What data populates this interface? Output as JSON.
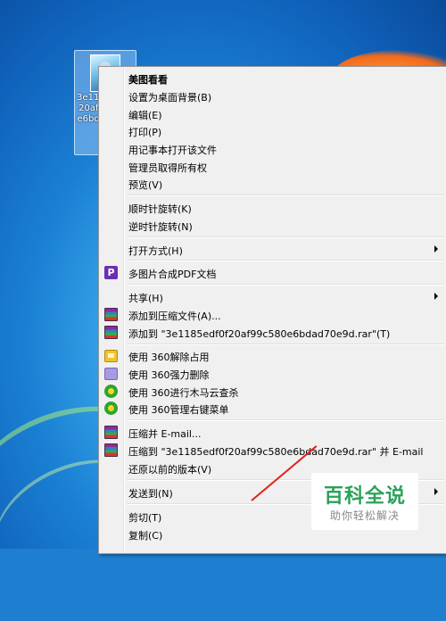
{
  "desktop_icon": {
    "filename": "3e1185edf0f20af99c580e6bdad70e9d"
  },
  "menu": {
    "items": [
      {
        "label": "美图看看",
        "bold": true
      },
      {
        "label": "设置为桌面背景(B)"
      },
      {
        "label": "编辑(E)"
      },
      {
        "label": "打印(P)"
      },
      {
        "label": "用记事本打开该文件"
      },
      {
        "label": "管理员取得所有权"
      },
      {
        "label": "预览(V)"
      },
      {
        "label": "顺时针旋转(K)"
      },
      {
        "label": "逆时针旋转(N)"
      },
      {
        "label": "打开方式(H)",
        "submenu": true
      },
      {
        "label": "多图片合成PDF文档",
        "icon": "pdf-merge-icon"
      },
      {
        "label": "共享(H)",
        "submenu": true
      },
      {
        "label": "添加到压缩文件(A)...",
        "icon": "winrar-icon"
      },
      {
        "label": "添加到 \"3e1185edf0f20af99c580e6bdad70e9d.rar\"(T)",
        "icon": "winrar-icon"
      },
      {
        "label": "使用 360解除占用",
        "icon": "unlock-360-icon"
      },
      {
        "label": "使用 360强力删除",
        "icon": "shred-360-icon"
      },
      {
        "label": "使用 360进行木马云查杀",
        "icon": "360-security-icon"
      },
      {
        "label": "使用 360管理右键菜单",
        "icon": "360-security-icon"
      },
      {
        "label": "压缩并 E-mail...",
        "icon": "winrar-icon"
      },
      {
        "label": "压缩到 \"3e1185edf0f20af99c580e6bdad70e9d.rar\" 并 E-mail",
        "icon": "winrar-icon"
      },
      {
        "label": "还原以前的版本(V)"
      },
      {
        "label": "发送到(N)",
        "submenu": true
      },
      {
        "label": "剪切(T)"
      },
      {
        "label": "复制(C)"
      }
    ]
  },
  "watermark": {
    "main": "百科全说",
    "sub": "助你轻松解决"
  },
  "colors": {
    "menu_bg": "#f0f0f0",
    "menu_border": "#979797",
    "watermark_green": "#2aa25a"
  }
}
